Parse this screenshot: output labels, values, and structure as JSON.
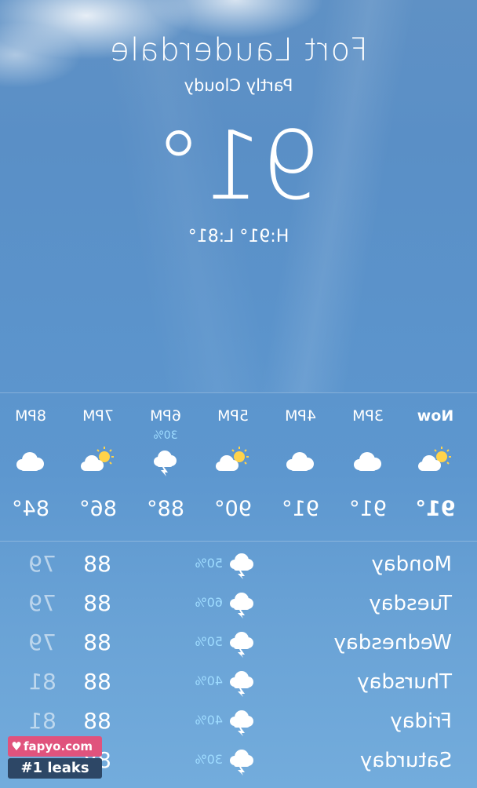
{
  "location": {
    "city": "Fort Lauderdale",
    "condition": "Partly Cloudy",
    "temperature": "91°",
    "high_low": "H:91°  L:81°"
  },
  "hourly": [
    {
      "label": "Now",
      "icon": "partly-sunny-icon",
      "temp": "91°",
      "precip": ""
    },
    {
      "label": "3PM",
      "icon": "cloud-icon",
      "temp": "91°",
      "precip": ""
    },
    {
      "label": "4PM",
      "icon": "cloud-icon",
      "temp": "91°",
      "precip": ""
    },
    {
      "label": "5PM",
      "icon": "partly-sunny-icon",
      "temp": "90°",
      "precip": ""
    },
    {
      "label": "6PM",
      "icon": "thunderstorm-icon",
      "temp": "88°",
      "precip": "30%"
    },
    {
      "label": "7PM",
      "icon": "partly-sunny-icon",
      "temp": "86°",
      "precip": ""
    },
    {
      "label": "8PM",
      "icon": "cloud-icon",
      "temp": "84°",
      "precip": ""
    }
  ],
  "daily": [
    {
      "day": "Monday",
      "icon": "thunderstorm-icon",
      "precip": "50%",
      "high": "88",
      "low": "79"
    },
    {
      "day": "Tuesday",
      "icon": "thunderstorm-icon",
      "precip": "60%",
      "high": "88",
      "low": "79"
    },
    {
      "day": "Wednesday",
      "icon": "thunderstorm-icon",
      "precip": "50%",
      "high": "88",
      "low": "79"
    },
    {
      "day": "Thursday",
      "icon": "thunderstorm-icon",
      "precip": "40%",
      "high": "88",
      "low": "81"
    },
    {
      "day": "Friday",
      "icon": "thunderstorm-icon",
      "precip": "40%",
      "high": "88",
      "low": "81"
    },
    {
      "day": "Saturday",
      "icon": "thunderstorm-icon",
      "precip": "30%",
      "high": "88",
      "low": ""
    }
  ],
  "watermark": {
    "site": "fapyo.com",
    "tagline": "#1 leaks"
  },
  "colors": {
    "precip_text": "#9fdcff",
    "watermark_pink": "#e0537d",
    "watermark_navy": "#2d4766"
  }
}
